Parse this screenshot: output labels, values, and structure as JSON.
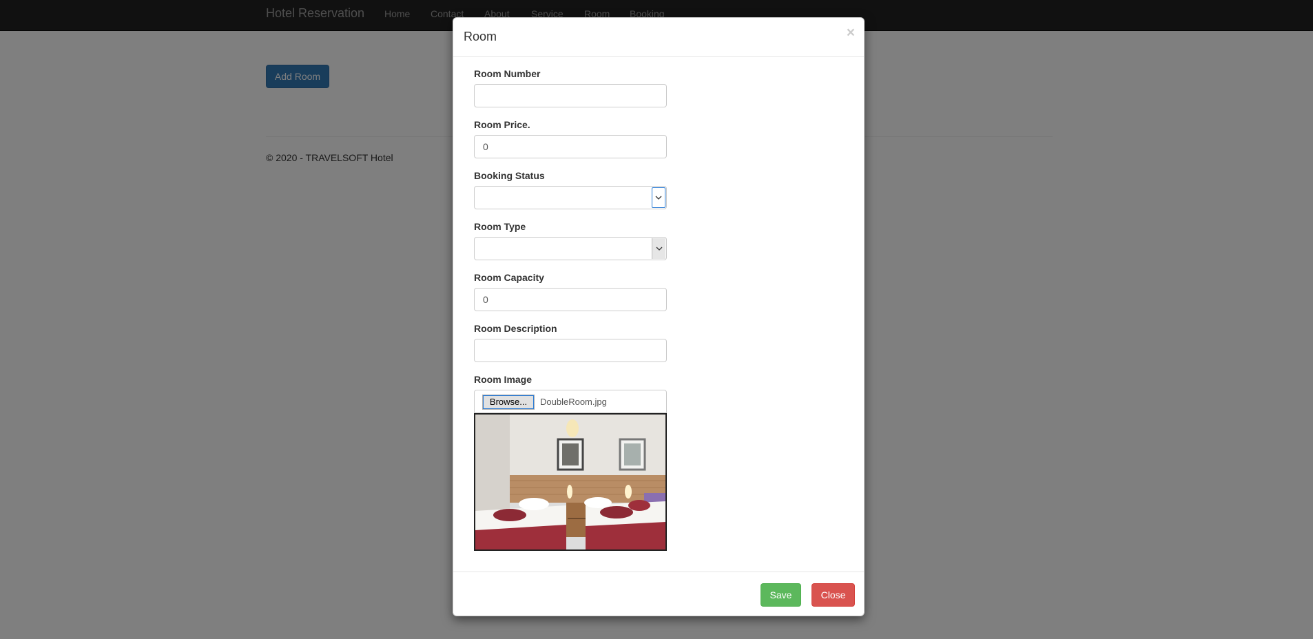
{
  "navbar": {
    "brand": "Hotel Reservation",
    "links": [
      "Home",
      "Contact",
      "About",
      "Service",
      "Room",
      "Booking"
    ]
  },
  "page": {
    "add_room_label": "Add Room",
    "footer": "© 2020 - TRAVELSOFT Hotel"
  },
  "modal": {
    "title": "Room",
    "close_symbol": "×",
    "fields": {
      "room_number": {
        "label": "Room Number",
        "value": ""
      },
      "room_price": {
        "label": "Room Price.",
        "value": "0"
      },
      "booking_status": {
        "label": "Booking Status",
        "selected": ""
      },
      "room_type": {
        "label": "Room Type",
        "selected": ""
      },
      "room_capacity": {
        "label": "Room Capacity",
        "value": "0"
      },
      "room_description": {
        "label": "Room Description",
        "value": ""
      },
      "room_image": {
        "label": "Room Image",
        "browse_label": "Browse...",
        "file_name": "DoubleRoom.jpg"
      }
    },
    "save_label": "Save",
    "close_label": "Close"
  },
  "colors": {
    "primary": "#337ab7",
    "success": "#5cb85c",
    "danger": "#d9534f",
    "navbar": "#222222"
  }
}
